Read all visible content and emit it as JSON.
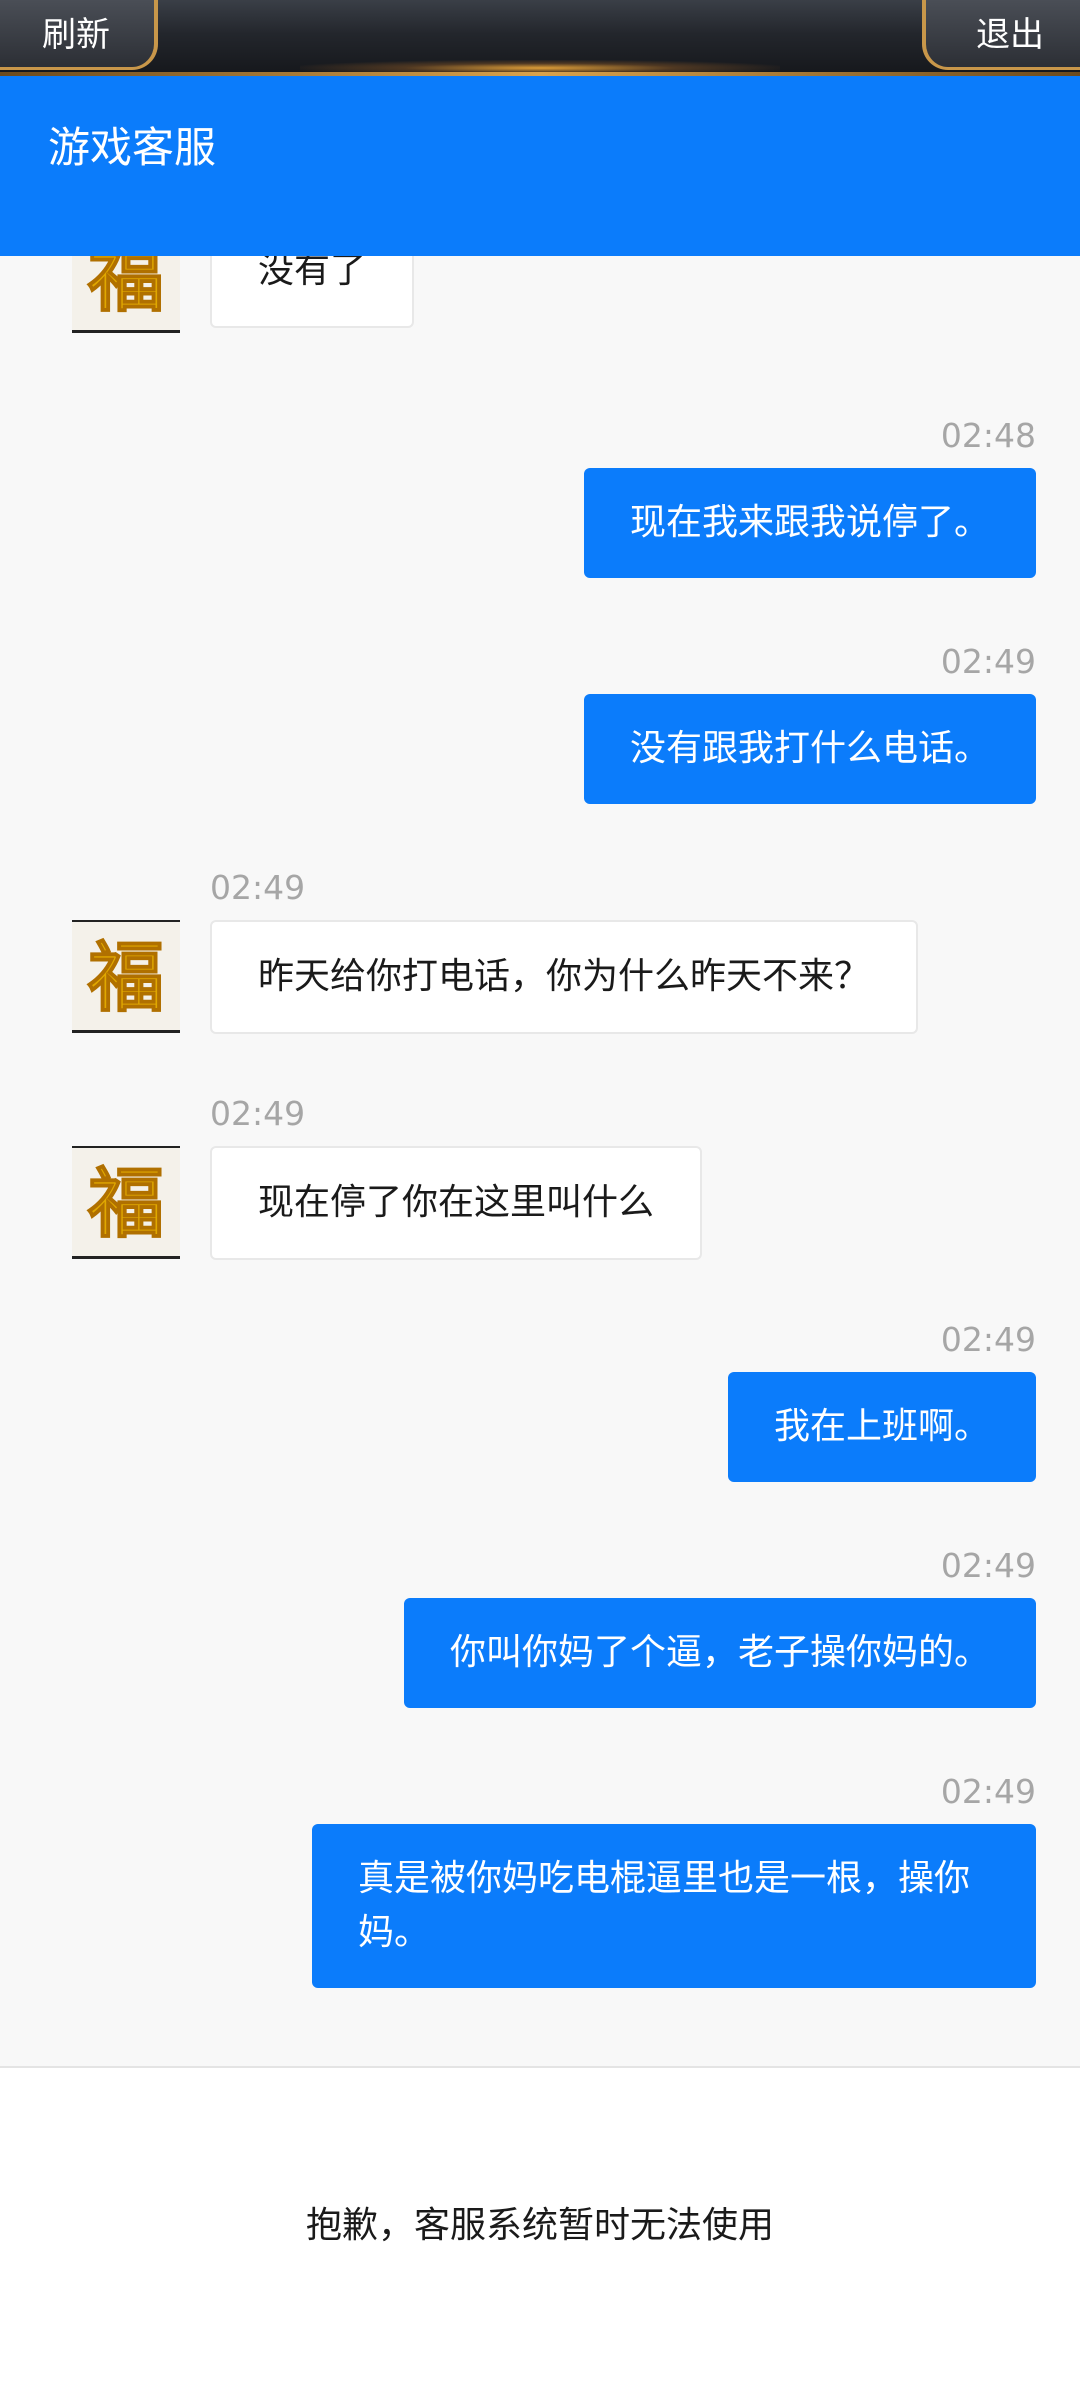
{
  "game_bar": {
    "refresh_label": "刷新",
    "exit_label": "退出"
  },
  "header": {
    "title": "游戏客服"
  },
  "messages": [
    {
      "side": "left",
      "time": "",
      "text": "没有了"
    },
    {
      "side": "right",
      "time": "02:48",
      "text": "现在我来跟我说停了。"
    },
    {
      "side": "right",
      "time": "02:49",
      "text": "没有跟我打什么电话。"
    },
    {
      "side": "left",
      "time": "02:49",
      "text": "昨天给你打电话，你为什么昨天不来？"
    },
    {
      "side": "left",
      "time": "02:49",
      "text": "现在停了你在这里叫什么"
    },
    {
      "side": "right",
      "time": "02:49",
      "text": "我在上班啊。"
    },
    {
      "side": "right",
      "time": "02:49",
      "text": "你叫你妈了个逼，老子操你妈的。"
    },
    {
      "side": "right",
      "time": "02:49",
      "text": "真是被你妈吃电棍逼里也是一根，操你妈。"
    }
  ],
  "footer": {
    "notice": "抱歉，客服系统暂时无法使用"
  },
  "colors": {
    "header_bg": "#0b7cfb",
    "bubble_self": "#0b7cfb",
    "bubble_other": "#ffffff",
    "chat_bg": "#f8f8f8",
    "timestamp": "#a6a6a6"
  }
}
